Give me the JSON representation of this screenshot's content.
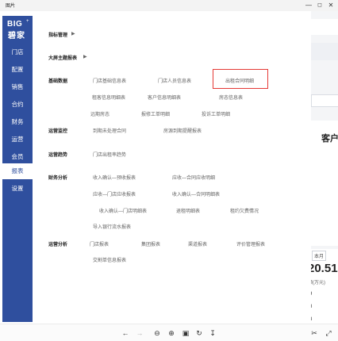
{
  "window": {
    "title": "图片",
    "minimize_icon": "minimize-icon",
    "maximize_icon": "maximize-icon",
    "close_icon": "close-icon"
  },
  "logo": {
    "top": "BIG",
    "star": "+",
    "bottom": "碧家"
  },
  "sidebar": {
    "items": [
      {
        "label": "门店"
      },
      {
        "label": "配置"
      },
      {
        "label": "销售"
      },
      {
        "label": "合约"
      },
      {
        "label": "财务"
      },
      {
        "label": "运营"
      },
      {
        "label": "会员"
      },
      {
        "label": "报表",
        "active": true
      },
      {
        "label": "设置"
      }
    ]
  },
  "menu": {
    "indicator_management": "指标管理",
    "dashboard_reports": "大屏主题报表",
    "sections": {
      "basic_data": {
        "title": "基础数据",
        "links": [
          "门店基础信息表",
          "门店人员信息表",
          "出租合同明细",
          "租客信息明细表",
          "客户信息明细表",
          "房态信息表",
          "远期房态",
          "报修工单明细",
          "投诉工单明细"
        ]
      },
      "ops_monitor": {
        "title": "运营监控",
        "links": [
          "到期未处理合同",
          "房源到期提醒报表"
        ]
      },
      "ops_trend": {
        "title": "运营趋势",
        "links": [
          "门店出租率趋势"
        ]
      },
      "finance": {
        "title": "财务分析",
        "links": [
          "收入确认—预收报表",
          "应收—合同应收明细",
          "应收—门店应收报表",
          "收入确认—合同明细表",
          "收入确认—门店明细表",
          "退租明细表",
          "租约欠费情况",
          "导入银行流水报表"
        ]
      },
      "ops_analysis": {
        "title": "运营分析",
        "links": [
          "门店报表",
          "集团报表",
          "渠道报表",
          "评价管理报表",
          "交割单信息报表"
        ]
      }
    }
  },
  "background_app": {
    "customer_label": "客户",
    "month_tag": "本月",
    "big_number": "20.51",
    "unit": "额(万元)",
    "values": [
      "9",
      "8",
      "3"
    ]
  },
  "highlight_color": "#e53935",
  "brand_color": "#2f4f9e"
}
